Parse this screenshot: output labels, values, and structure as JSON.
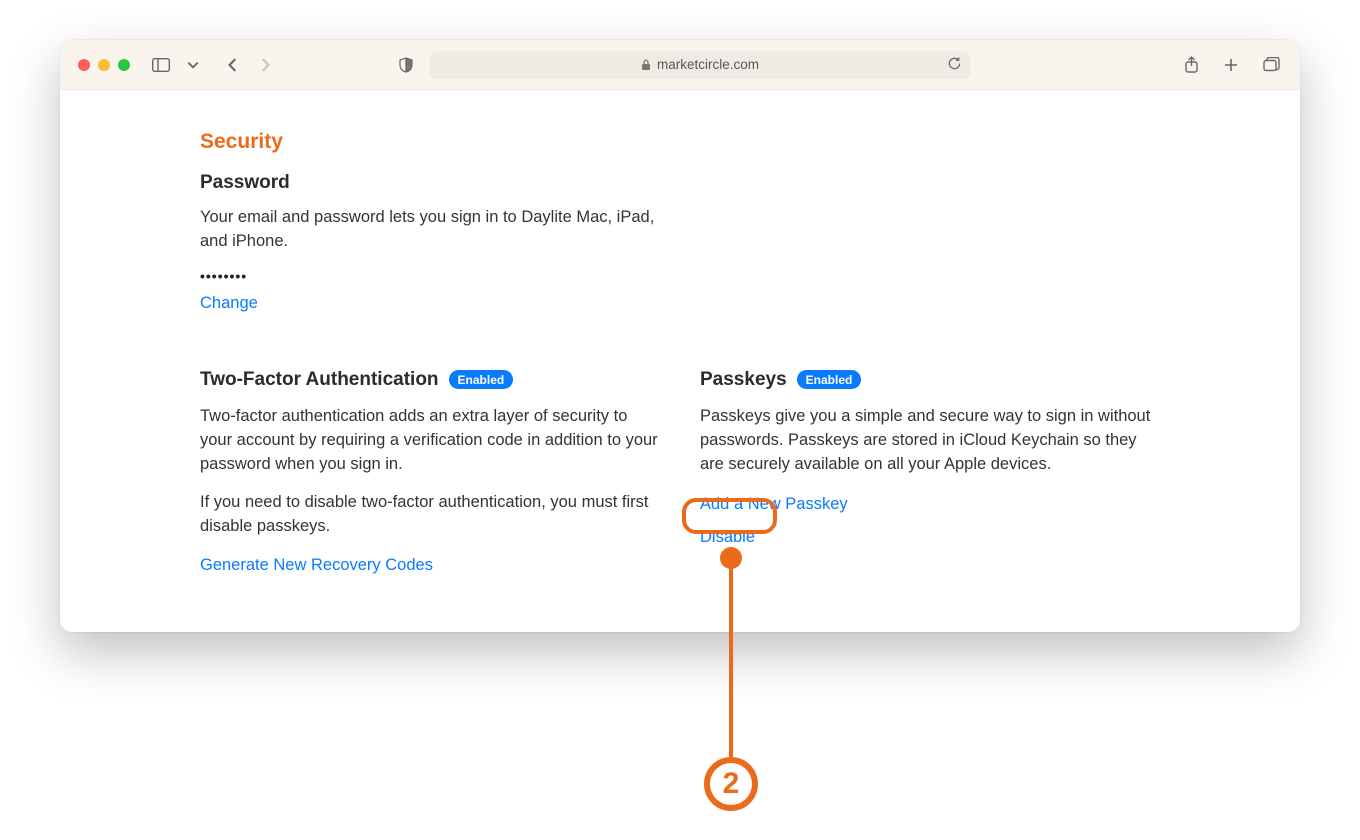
{
  "browser": {
    "url_display": "marketcircle.com"
  },
  "page": {
    "title": "Security",
    "password": {
      "heading": "Password",
      "description": "Your email and password lets you sign in to Daylite Mac, iPad, and iPhone.",
      "masked": "••••••••",
      "change_label": "Change"
    },
    "tfa": {
      "heading": "Two-Factor Authentication",
      "badge": "Enabled",
      "desc1": "Two-factor authentication adds an extra layer of security to your account by requiring a verification code in addition to your password when you sign in.",
      "desc2": "If you need to disable two-factor authentication, you must first disable passkeys.",
      "recovery_label": "Generate New Recovery Codes"
    },
    "passkeys": {
      "heading": "Passkeys",
      "badge": "Enabled",
      "desc": "Passkeys give you a simple and secure way to sign in without passwords. Passkeys are stored in iCloud Keychain so they are securely available on all your Apple devices.",
      "add_label": "Add a New Passkey",
      "disable_label": "Disable"
    }
  },
  "annotation": {
    "number": "2"
  },
  "colors": {
    "accent_orange": "#ec6b1a",
    "link_blue": "#0a7aff"
  }
}
